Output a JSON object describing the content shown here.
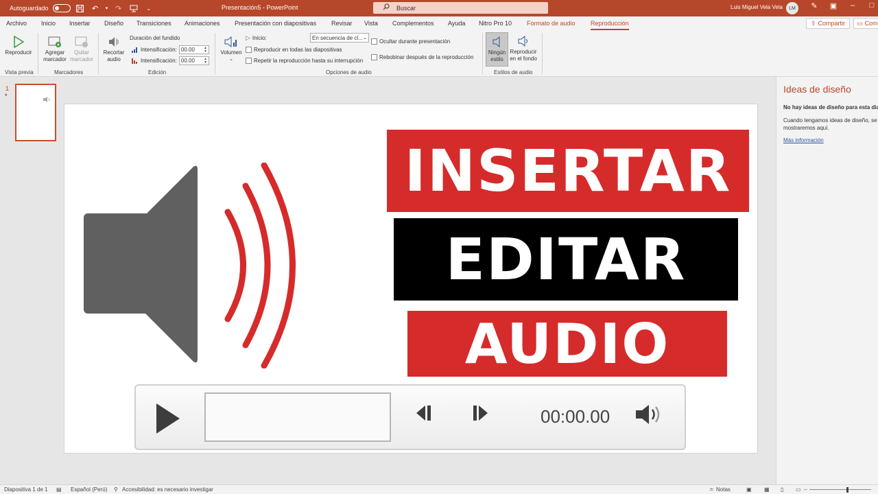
{
  "titlebar": {
    "autosave_label": "Autoguardado",
    "title": "Presentación5  -  PowerPoint",
    "search_placeholder": "Buscar",
    "user_name": "Luis Miguel Vela Vela",
    "user_initials": "LM"
  },
  "tabs": [
    "Archivo",
    "Inicio",
    "Insertar",
    "Diseño",
    "Transiciones",
    "Animaciones",
    "Presentación con diapositivas",
    "Revisar",
    "Vista",
    "Complementos",
    "Ayuda",
    "Nitro Pro 10",
    "Formato de audio",
    "Reproducción"
  ],
  "share": {
    "label": "Compartir",
    "label2": "Com"
  },
  "ribbon": {
    "preview": {
      "play": "Reproducir",
      "group": "Vista previa"
    },
    "bookmarks": {
      "add_l1": "Agregar",
      "add_l2": "marcador",
      "remove_l1": "Quitar",
      "remove_l2": "marcador",
      "group": "Marcadores"
    },
    "edit": {
      "trim_l1": "Recortar",
      "trim_l2": "audio",
      "fade_title": "Duración del fundido",
      "fade_in_label": "Intensificación:",
      "fade_in_value": "00.00",
      "fade_out_label": "Intensificación:",
      "fade_out_value": "00.00",
      "group": "Edición"
    },
    "options": {
      "volume": "Volumen",
      "start_label": "Inicio:",
      "start_value": "En secuencia de cl...",
      "play_across": "Reproducir en todas las diapositivas",
      "loop": "Repetir la reproducción hasta su interrupción",
      "hide": "Ocultar durante presentación",
      "rewind": "Rebobinar después de la reproducción",
      "group": "Opciones de audio"
    },
    "styles": {
      "none_l1": "Ningún",
      "none_l2": "estilo",
      "bg_l1": "Reproducir",
      "bg_l2": "en el fondo",
      "group": "Estilos de audio"
    }
  },
  "thumbs": {
    "number": "1",
    "star": "*"
  },
  "slide": {
    "banner1": "INSERTAR",
    "banner2": "EDITAR",
    "banner3": "AUDIO",
    "player_time": "00:00.00"
  },
  "design_pane": {
    "title": "Ideas de diseño",
    "heading": "No hay ideas de diseño para esta diapositiva",
    "text": "Cuando tengamos ideas de diseño, se las mostraremos aquí.",
    "link": "Más información"
  },
  "status": {
    "slide": "Diapositiva 1 de 1",
    "language": "Español (Perú)",
    "accessibility": "Accesibilidad: es necesario investigar",
    "notes": "Notas"
  },
  "colors": {
    "accent": "#b7472a",
    "red_banner": "#d62b2b",
    "speaker_gray": "#606060"
  }
}
